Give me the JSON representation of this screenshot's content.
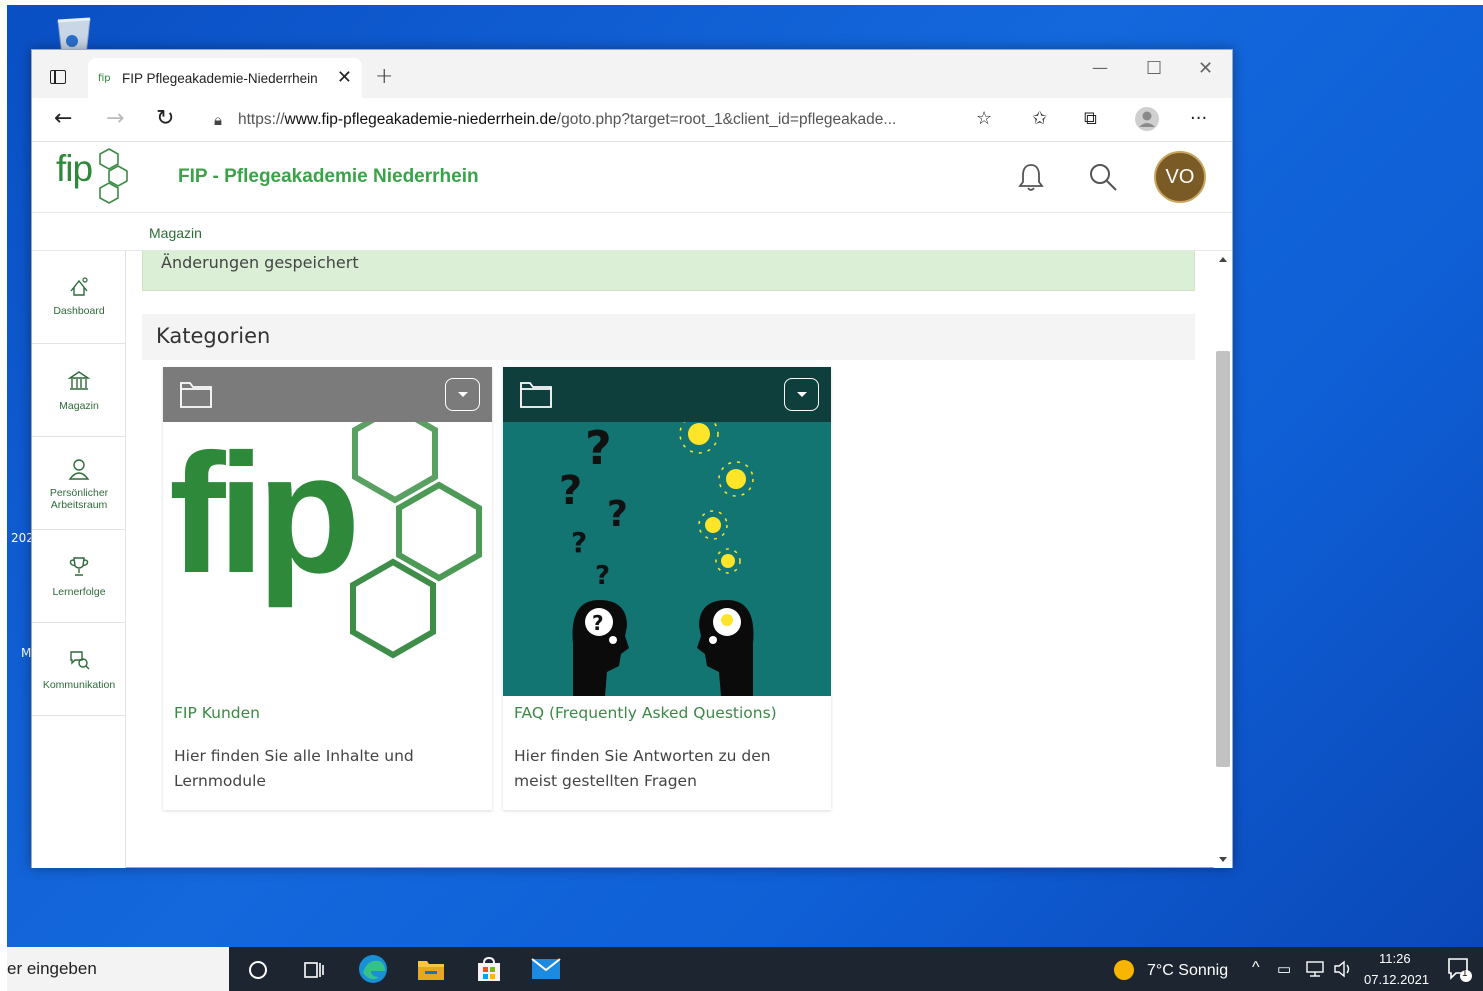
{
  "browser": {
    "tab_title": "FIP Pflegeakademie-Niederrhein",
    "tab_favicon_text": "fip",
    "url_prefix": "https://",
    "url_domain": "www.fip-pflegeakademie-niederrhein.de",
    "url_path": "/goto.php?target=root_1&client_id=pflegeakade..."
  },
  "site": {
    "logo_text": "fip",
    "title": "FIP - Pflegeakademie Niederrhein",
    "avatar_initials": "VO",
    "breadcrumb": "Magazin",
    "accent_color": "#2e8a3a"
  },
  "sidebar": {
    "items": [
      {
        "label": "Dashboard",
        "icon": "dashboard-icon"
      },
      {
        "label": "Magazin",
        "icon": "magazine-icon"
      },
      {
        "label": "Persönlicher Arbeitsraum",
        "icon": "person-icon"
      },
      {
        "label": "Lernerfolge",
        "icon": "trophy-icon"
      },
      {
        "label": "Kommunikation",
        "icon": "chat-icon"
      }
    ]
  },
  "content": {
    "alert": "Änderungen gespeichert",
    "section_title": "Kategorien",
    "cards": [
      {
        "title": "FIP Kunden",
        "description": "Hier finden Sie alle Inhalte und Lernmodule",
        "image_text": "fip"
      },
      {
        "title": "FAQ (Frequently Asked Questions)",
        "description": "Hier finden Sie Antworten zu den meist gestellten Fragen"
      }
    ]
  },
  "desktop": {
    "fragment_1": "202",
    "fragment_2": "M"
  },
  "taskbar": {
    "search_text": "er eingeben",
    "weather": "7°C  Sonnig",
    "time": "11:26",
    "date": "07.12.2021",
    "notification_count": "1"
  }
}
